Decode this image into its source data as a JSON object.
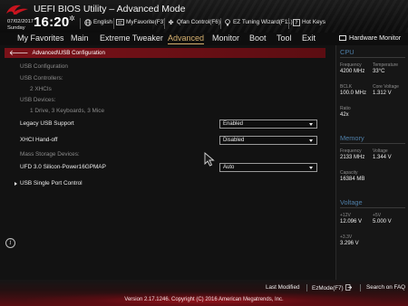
{
  "header": {
    "title": "UEFI BIOS Utility – Advanced Mode",
    "date": "07/02/2017",
    "day": "Sunday",
    "time": "16:20",
    "tools": [
      {
        "label": "English",
        "icon": "globe-icon"
      },
      {
        "label": "MyFavorite(F3)",
        "icon": "favorite-icon"
      },
      {
        "label": "Qfan Control(F6)",
        "icon": "fan-icon"
      },
      {
        "label": "EZ Tuning Wizard(F11)",
        "icon": "lightbulb-icon"
      },
      {
        "label": "Hot Keys",
        "icon": "question-icon"
      }
    ]
  },
  "menu": {
    "items": [
      "My Favorites",
      "Main",
      "Extreme Tweaker",
      "Advanced",
      "Monitor",
      "Boot",
      "Tool",
      "Exit"
    ],
    "active": "Advanced"
  },
  "breadcrumb": "Advanced\\USB Configuration",
  "content": {
    "usb_configuration": "USB Configuration",
    "usb_controllers_label": "USB Controllers:",
    "usb_controllers_value": "2 XHCIs",
    "usb_devices_label": "USB Devices:",
    "usb_devices_value": "1 Drive, 3 Keyboards, 3 Mice",
    "legacy_usb_label": "Legacy USB Support",
    "legacy_usb_value": "Enabled",
    "xhci_label": "XHCI Hand-off",
    "xhci_value": "Disabled",
    "mass_storage_label": "Mass Storage Devices:",
    "ufd_label": "UFD 3.0 Silicon-Power16GPMAP",
    "ufd_value": "Auto",
    "single_port_label": "USB Single Port Control"
  },
  "hardware_monitor": {
    "title": "Hardware Monitor",
    "cpu": {
      "section": "CPU",
      "frequency_label": "Frequency",
      "frequency": "4200 MHz",
      "temperature_label": "Temperature",
      "temperature": "33°C",
      "bclk_label": "BCLK",
      "bclk": "100.0 MHz",
      "core_voltage_label": "Core Voltage",
      "core_voltage": "1.312 V",
      "ratio_label": "Ratio",
      "ratio": "42x"
    },
    "memory": {
      "section": "Memory",
      "frequency_label": "Frequency",
      "frequency": "2133 MHz",
      "voltage_label": "Voltage",
      "voltage": "1.344 V",
      "capacity_label": "Capacity",
      "capacity": "16384 MB"
    },
    "voltage": {
      "section": "Voltage",
      "v12_label": "+12V",
      "v12": "12.096 V",
      "v5_label": "+5V",
      "v5": "5.000 V",
      "v33_label": "+3.3V",
      "v33": "3.296 V"
    }
  },
  "footer": {
    "last_modified": "Last Modified",
    "ezmode": "EzMode(F7)",
    "search": "Search on FAQ",
    "version": "Version 2.17.1246. Copyright (C) 2016 American Megatrends, Inc."
  },
  "colors": {
    "accent_red": "#7a1219",
    "active_menu": "#d8b270",
    "section_blue": "#4f7fa8"
  }
}
